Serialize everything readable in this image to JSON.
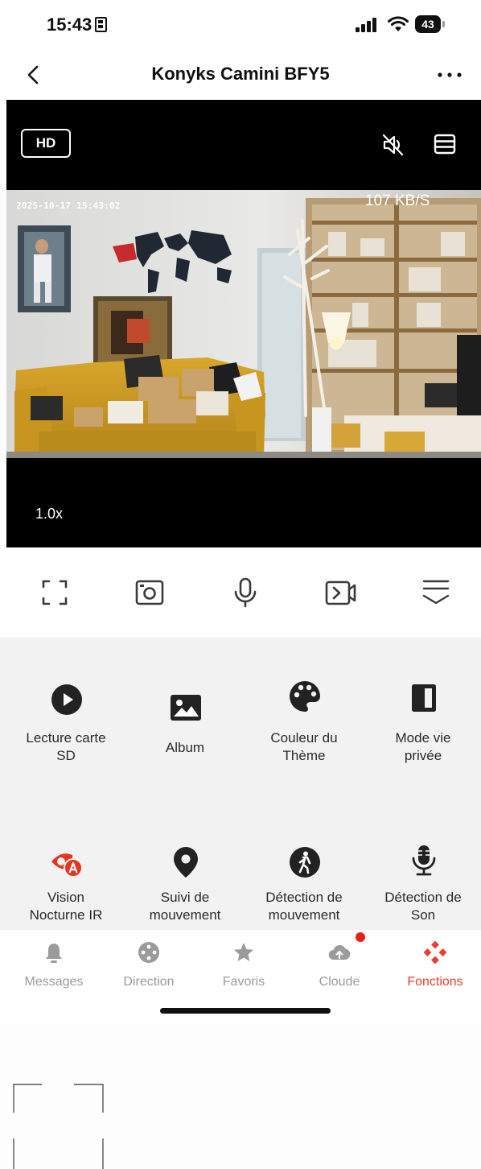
{
  "status_bar": {
    "time": "15:43",
    "battery": "43"
  },
  "header": {
    "title": "Konyks Camini BFY5"
  },
  "video": {
    "quality_label": "HD",
    "timestamp": "2025-10-17 15:43:02",
    "speed": "107 KB/S",
    "zoom": "1.0x"
  },
  "controls": [
    {
      "name": "fullscreen-icon"
    },
    {
      "name": "screenshot-icon"
    },
    {
      "name": "microphone-icon"
    },
    {
      "name": "record-video-icon"
    },
    {
      "name": "collapse-icon"
    }
  ],
  "functions": [
    {
      "label": "Lecture carte SD",
      "lines": [
        "Lecture carte",
        "SD"
      ],
      "icon": "play-circle-icon"
    },
    {
      "label": "Album",
      "lines": [
        "Album"
      ],
      "icon": "image-icon"
    },
    {
      "label": "Couleur du Thème",
      "lines": [
        "Couleur du",
        "Thème"
      ],
      "icon": "palette-icon"
    },
    {
      "label": "Mode vie privée",
      "lines": [
        "Mode vie",
        "privée"
      ],
      "icon": "shield-half-icon"
    },
    {
      "label": "Vision Nocturne IR",
      "lines": [
        "Vision",
        "Nocturne IR"
      ],
      "icon": "night-vision-icon"
    },
    {
      "label": "Suivi de mouvement",
      "lines": [
        "Suivi de",
        "mouvement"
      ],
      "icon": "location-pin-icon"
    },
    {
      "label": "Détection de mouvement",
      "lines": [
        "Détection de",
        "mouvement"
      ],
      "icon": "walking-person-icon"
    },
    {
      "label": "Détection de Son",
      "lines": [
        "Détection de",
        "Son"
      ],
      "icon": "podcast-microphone-icon"
    }
  ],
  "tabs": [
    {
      "label": "Messages",
      "icon": "bell-icon",
      "active": false
    },
    {
      "label": "Direction",
      "icon": "dpad-icon",
      "active": false
    },
    {
      "label": "Favoris",
      "icon": "star-icon",
      "active": false
    },
    {
      "label": "Cloude",
      "icon": "cloud-upload-icon",
      "active": false
    },
    {
      "label": "Fonctions",
      "icon": "functions-grid-icon",
      "active": true
    }
  ],
  "colors": {
    "accent": "#ee3d32",
    "night_vision_icon": "#e8341f",
    "notification_dot": "#e8201c",
    "panel_bg": "#f2f2f2"
  }
}
